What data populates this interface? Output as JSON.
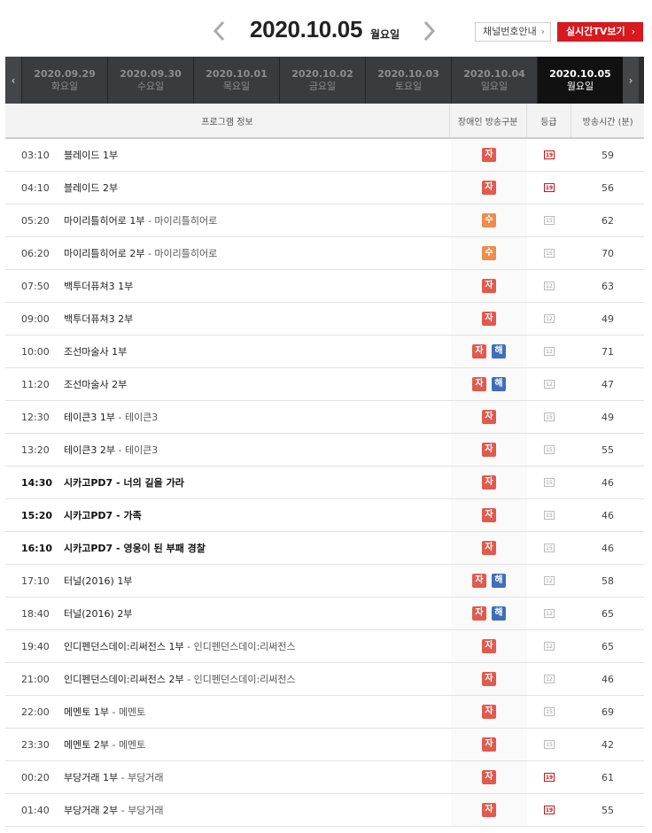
{
  "header": {
    "date": "2020.10.05",
    "weekday": "월요일",
    "channel_button": "채널번호안내",
    "live_button": "실시간TV보기"
  },
  "days": [
    {
      "date": "2020.09.29",
      "weekday": "화요일",
      "active": false
    },
    {
      "date": "2020.09.30",
      "weekday": "수요일",
      "active": false
    },
    {
      "date": "2020.10.01",
      "weekday": "목요일",
      "active": false
    },
    {
      "date": "2020.10.02",
      "weekday": "금요일",
      "active": false
    },
    {
      "date": "2020.10.03",
      "weekday": "토요일",
      "active": false
    },
    {
      "date": "2020.10.04",
      "weekday": "일요일",
      "active": false
    },
    {
      "date": "2020.10.05",
      "weekday": "월요일",
      "active": true
    }
  ],
  "columns": {
    "program": "프로그램 정보",
    "disability": "장애인 방송구분",
    "grade": "등급",
    "duration": "방송시간 (분)"
  },
  "rows": [
    {
      "time": "03:10",
      "title": "블레이드 1부",
      "sub": "",
      "badges": [
        "자"
      ],
      "grade": "19",
      "duration": "59",
      "bold": false
    },
    {
      "time": "04:10",
      "title": "블레이드 2부",
      "sub": "",
      "badges": [
        "자"
      ],
      "grade": "19",
      "duration": "56",
      "bold": false
    },
    {
      "time": "05:20",
      "title": "마이리틀히어로 1부",
      "sub": " - 마이리틀히어로",
      "badges": [
        "수"
      ],
      "grade": "15",
      "duration": "62",
      "bold": false
    },
    {
      "time": "06:20",
      "title": "마이리틀히어로 2부",
      "sub": " - 마이리틀히어로",
      "badges": [
        "수"
      ],
      "grade": "15",
      "duration": "70",
      "bold": false
    },
    {
      "time": "07:50",
      "title": "백투더퓨쳐3 1부",
      "sub": "",
      "badges": [
        "자"
      ],
      "grade": "12",
      "duration": "63",
      "bold": false
    },
    {
      "time": "09:00",
      "title": "백투더퓨쳐3 2부",
      "sub": "",
      "badges": [
        "자"
      ],
      "grade": "12",
      "duration": "49",
      "bold": false
    },
    {
      "time": "10:00",
      "title": "조선마술사 1부",
      "sub": "",
      "badges": [
        "자",
        "해"
      ],
      "grade": "12",
      "duration": "71",
      "bold": false
    },
    {
      "time": "11:20",
      "title": "조선마술사 2부",
      "sub": "",
      "badges": [
        "자",
        "해"
      ],
      "grade": "12",
      "duration": "47",
      "bold": false
    },
    {
      "time": "12:30",
      "title": "테이큰3 1부",
      "sub": " - 테이큰3",
      "badges": [
        "자"
      ],
      "grade": "15",
      "duration": "49",
      "bold": false
    },
    {
      "time": "13:20",
      "title": "테이큰3 2부",
      "sub": " - 테이큰3",
      "badges": [
        "자"
      ],
      "grade": "15",
      "duration": "55",
      "bold": false
    },
    {
      "time": "14:30",
      "title": "시카고PD7",
      "sub": " - 너의 길을 가라",
      "badges": [
        "자"
      ],
      "grade": "15",
      "duration": "46",
      "bold": true
    },
    {
      "time": "15:20",
      "title": "시카고PD7",
      "sub": " - 가족",
      "badges": [
        "자"
      ],
      "grade": "15",
      "duration": "46",
      "bold": true
    },
    {
      "time": "16:10",
      "title": "시카고PD7",
      "sub": " - 영웅이 된 부패 경찰",
      "badges": [
        "자"
      ],
      "grade": "15",
      "duration": "46",
      "bold": true
    },
    {
      "time": "17:10",
      "title": "터널(2016) 1부",
      "sub": "",
      "badges": [
        "자",
        "해"
      ],
      "grade": "12",
      "duration": "58",
      "bold": false
    },
    {
      "time": "18:40",
      "title": "터널(2016) 2부",
      "sub": "",
      "badges": [
        "자",
        "해"
      ],
      "grade": "12",
      "duration": "65",
      "bold": false
    },
    {
      "time": "19:40",
      "title": "인디펜던스데이:리써전스 1부",
      "sub": " - 인디펜던스데이:리써전스",
      "badges": [
        "자"
      ],
      "grade": "12",
      "duration": "65",
      "bold": false
    },
    {
      "time": "21:00",
      "title": "인디펜던스데이:리써전스 2부",
      "sub": " - 인디펜던스데이:리써전스",
      "badges": [
        "자"
      ],
      "grade": "12",
      "duration": "46",
      "bold": false
    },
    {
      "time": "22:00",
      "title": "메멘토 1부",
      "sub": " - 메멘토",
      "badges": [
        "자"
      ],
      "grade": "15",
      "duration": "69",
      "bold": false
    },
    {
      "time": "23:30",
      "title": "메멘토 2부",
      "sub": " - 메멘토",
      "badges": [
        "자"
      ],
      "grade": "15",
      "duration": "42",
      "bold": false
    },
    {
      "time": "00:20",
      "title": "부당거래 1부",
      "sub": " - 부당거래",
      "badges": [
        "자"
      ],
      "grade": "19",
      "duration": "61",
      "bold": false
    },
    {
      "time": "01:40",
      "title": "부당거래 2부",
      "sub": " - 부당거래",
      "badges": [
        "자"
      ],
      "grade": "19",
      "duration": "55",
      "bold": false
    }
  ]
}
